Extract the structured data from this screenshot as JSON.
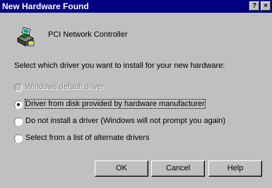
{
  "window": {
    "title": "New Hardware Found",
    "help_btn": "?",
    "close_btn": "×"
  },
  "device_name": "PCI Network Controller",
  "instructions": "Select which driver you want to install for your new hardware:",
  "options": [
    {
      "label": "Windows default driver",
      "enabled": false,
      "selected": false
    },
    {
      "label": "Driver from disk provided by hardware manufacturer",
      "enabled": true,
      "selected": true
    },
    {
      "label": "Do not install a driver (Windows will not prompt you again)",
      "enabled": true,
      "selected": false
    },
    {
      "label": "Select from a list of alternate drivers",
      "enabled": true,
      "selected": false
    }
  ],
  "buttons": {
    "ok": "OK",
    "cancel": "Cancel",
    "help": "Help"
  },
  "icon": "hardware-device-icon"
}
